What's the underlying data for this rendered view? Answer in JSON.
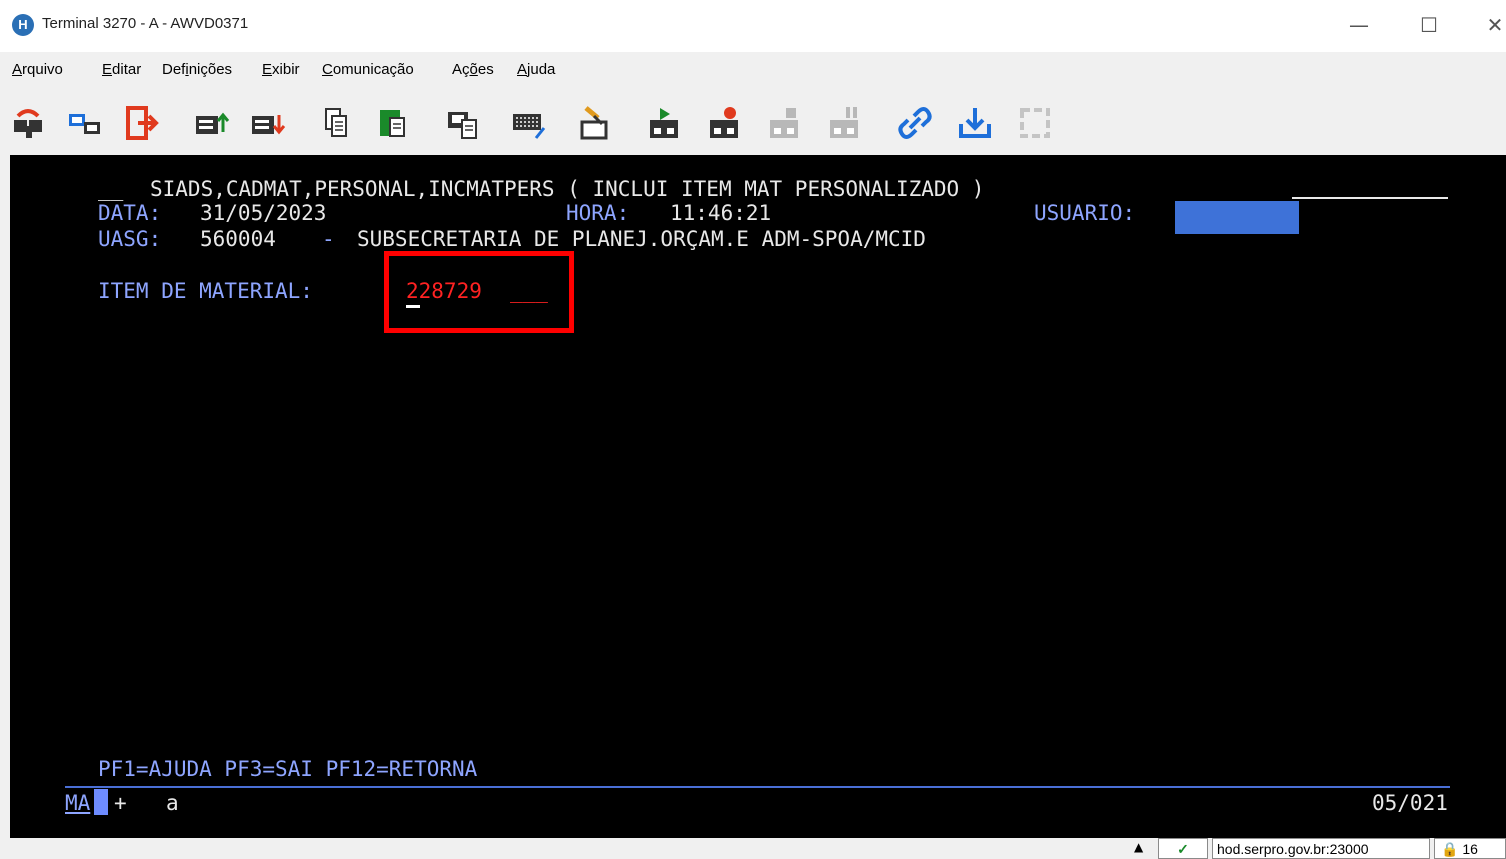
{
  "window": {
    "title": "Terminal 3270 - A - AWVD0371",
    "app_icon_letter": "H",
    "minimize": "—",
    "maximize": "☐",
    "close": "✕"
  },
  "menu": {
    "items": [
      {
        "first": "A",
        "rest": "rquivo"
      },
      {
        "first": "E",
        "rest": "ditar"
      },
      {
        "pre": "Def",
        "first": "i",
        "rest": "nições"
      },
      {
        "first": "E",
        "rest": "xibir"
      },
      {
        "first": "C",
        "rest": "omunicação"
      },
      {
        "pre": "Aç",
        "first": "õ",
        "rest": "es"
      },
      {
        "first": "A",
        "rest": "juda"
      }
    ]
  },
  "toolbar": {
    "icons": [
      "disconnect-icon",
      "connect-icon",
      "exit-icon",
      "send-file-icon",
      "receive-file-icon",
      "copy-icon",
      "paste-icon",
      "print-screen-icon",
      "keyboard-icon",
      "clear-icon",
      "record-macro-play-icon",
      "record-macro-icon",
      "stop-macro-icon",
      "pause-macro-icon",
      "link-icon",
      "download-icon",
      "refresh-icon"
    ]
  },
  "terminal": {
    "header_prefix": "__",
    "header_text": "SIADS,CADMAT,PERSONAL,INCMATPERS ( INCLUI ITEM MAT PERSONALIZADO )",
    "date_label": "DATA:",
    "date_value": "31/05/2023",
    "time_label": "HORA:",
    "time_value": "11:46:21",
    "user_label": "USUARIO:",
    "uasg_label": "UASG:",
    "uasg_code": "560004",
    "uasg_sep": "-",
    "uasg_name": "SUBSECRETARIA DE PLANEJ.ORÇAM.E ADM-SPOA/MCID",
    "item_label": "ITEM DE MATERIAL:",
    "item_value": "228729",
    "item_fill": "___",
    "pf_keys": "PF1=AJUDA PF3=SAI PF12=RETORNA",
    "oia_mode": "MA",
    "oia_plus": "+",
    "oia_a": "a",
    "cursor_pos": "05/021"
  },
  "statusbar": {
    "arrow": "▲",
    "check": "✓",
    "host": "hod.serpro.gov.br:23000",
    "lock": "🔒",
    "extra": "16"
  }
}
